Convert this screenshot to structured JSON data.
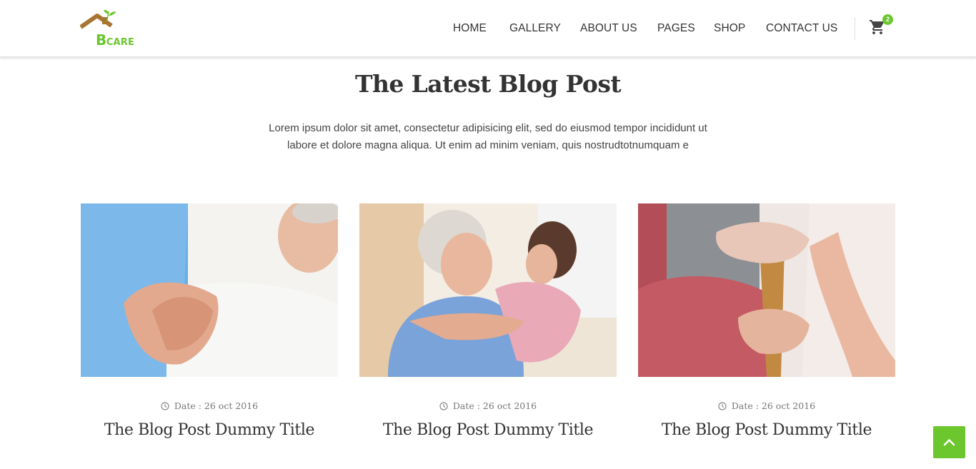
{
  "brand": {
    "logo_letter": "B",
    "logo_word": "CARE",
    "accent": "#6cc62d",
    "roof": "#a87532"
  },
  "nav": {
    "items": [
      {
        "label": "HOME"
      },
      {
        "label": "GALLERY"
      },
      {
        "label": "ABOUT US"
      },
      {
        "label": "PAGES"
      },
      {
        "label": "SHOP"
      },
      {
        "label": "CONTACT US"
      }
    ],
    "cart_icon": "cart-icon",
    "cart_count": "2"
  },
  "section": {
    "title": "The Latest Blog Post",
    "description_line1": "Lorem ipsum dolor sit amet, consectetur adipisicing elit, sed do eiusmod tempor incididunt ut",
    "description_line2": "labore et dolore magna aliqua. Ut enim ad minim veniam, quis nostrudtotnumquam e"
  },
  "posts": [
    {
      "date": "Date : 26 oct 2016",
      "title": "The Blog Post Dummy Title",
      "image": "caregiver-holding-hands-photo"
    },
    {
      "date": "Date : 26 oct 2016",
      "title": "The Blog Post Dummy Title",
      "image": "caregiver-hugging-elderly-woman-photo"
    },
    {
      "date": "Date : 26 oct 2016",
      "title": "The Blog Post Dummy Title",
      "image": "hands-on-walking-cane-photo"
    }
  ],
  "back_to_top_icon": "chevron-up-icon"
}
